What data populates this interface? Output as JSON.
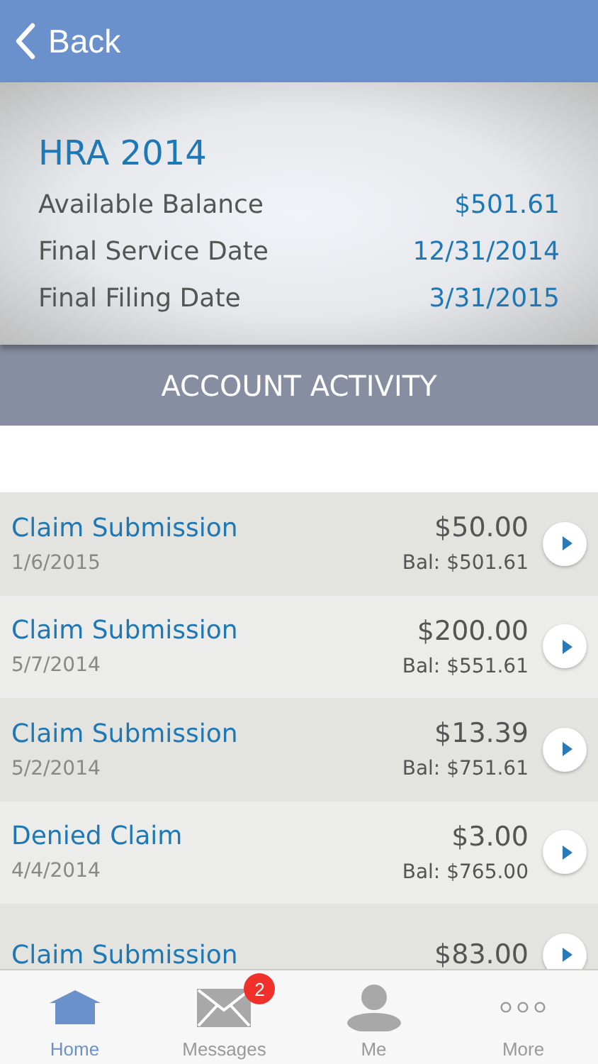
{
  "nav": {
    "back": "Back"
  },
  "account": {
    "title": "HRA 2014",
    "fields": [
      {
        "label": "Available Balance",
        "value": "$501.61"
      },
      {
        "label": "Final Service Date",
        "value": "12/31/2014"
      },
      {
        "label": "Final Filing Date",
        "value": "3/31/2015"
      }
    ]
  },
  "section_title": "ACCOUNT ACTIVITY",
  "activity": [
    {
      "title": "Claim Submission",
      "date": "1/6/2015",
      "amount": "$50.00",
      "balance": "Bal: $501.61"
    },
    {
      "title": "Claim Submission",
      "date": "5/7/2014",
      "amount": "$200.00",
      "balance": "Bal: $551.61"
    },
    {
      "title": "Claim Submission",
      "date": "5/2/2014",
      "amount": "$13.39",
      "balance": "Bal: $751.61"
    },
    {
      "title": "Denied Claim",
      "date": "4/4/2014",
      "amount": "$3.00",
      "balance": "Bal: $765.00"
    },
    {
      "title": "Claim Submission",
      "amount": "$83.00"
    }
  ],
  "tabs": [
    {
      "kind": "home",
      "label": "Home",
      "selected": true
    },
    {
      "kind": "messages",
      "label": "Messages",
      "selected": false,
      "badge": "2"
    },
    {
      "kind": "me",
      "label": "Me",
      "selected": false
    },
    {
      "kind": "more",
      "label": "More",
      "selected": false
    }
  ]
}
